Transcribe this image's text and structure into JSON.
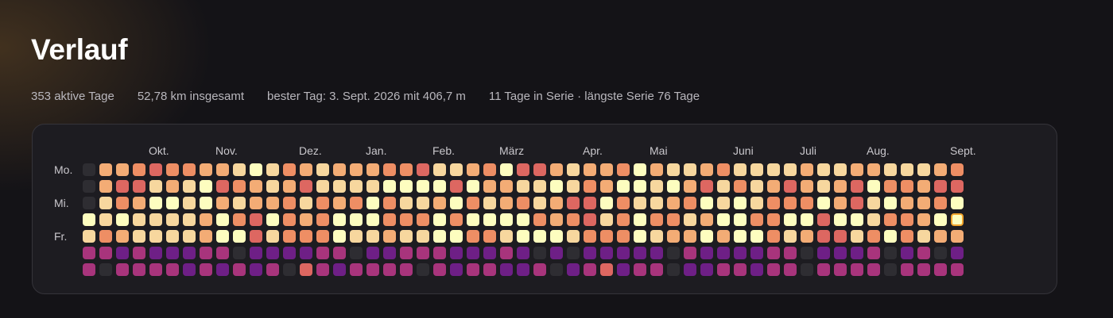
{
  "header": {
    "title": "Verlauf"
  },
  "stats": {
    "active_days": "353 aktive Tage",
    "total_distance": "52,78 km insgesamt",
    "best_day": "bester Tag: 3. Sept. 2026 mit 406,7 m",
    "streak": "11 Tage in Serie · längste Serie 76 Tage"
  },
  "heatmap": {
    "months": [
      {
        "label": "Okt.",
        "week": 4
      },
      {
        "label": "Nov.",
        "week": 8
      },
      {
        "label": "Dez.",
        "week": 13
      },
      {
        "label": "Jan.",
        "week": 17
      },
      {
        "label": "Feb.",
        "week": 21
      },
      {
        "label": "März",
        "week": 25
      },
      {
        "label": "Apr.",
        "week": 30
      },
      {
        "label": "Mai",
        "week": 34
      },
      {
        "label": "Juni",
        "week": 39
      },
      {
        "label": "Juli",
        "week": 43
      },
      {
        "label": "Aug.",
        "week": 47
      },
      {
        "label": "Sept.",
        "week": 52
      }
    ],
    "day_labels": [
      {
        "label": "Mo.",
        "row": 0
      },
      {
        "label": "Mi.",
        "row": 2
      },
      {
        "label": "Fr.",
        "row": 4
      }
    ],
    "weeks": 53,
    "days_per_week": 7,
    "legend_note": "levels: 0 = no activity, 1 = very high (light yellow) ... 5 = low (orange-red); weekend levels 6 = magenta, 7 = purple",
    "colors": {
      "empty": "#2e2d32",
      "level_1": "#fdfdbf",
      "level_2": "#f7d79e",
      "level_3": "#f3ac75",
      "level_4": "#ee8e64",
      "level_5": "#dd6761",
      "weekend_1": "#a8347c",
      "weekend_2": "#6e1f86",
      "today_border": "#f2a42c"
    },
    "rows": [
      "0334544332124323334452234155323341322342222322332223435",
      "0355232154323522221111513322124311213524235323514435512",
      "0243112132334243414223142342355142234121244413521334155",
      "1212222314514341114441411114345241442311441151124431112",
      "2432222311524441223221144211124441233131142355241423334",
      "6676777660777766077666777670707777706777766077760760766",
      "6066667676760567666606766776076576607766766066660666660"
    ],
    "today": {
      "week": 52,
      "day": 3
    }
  }
}
